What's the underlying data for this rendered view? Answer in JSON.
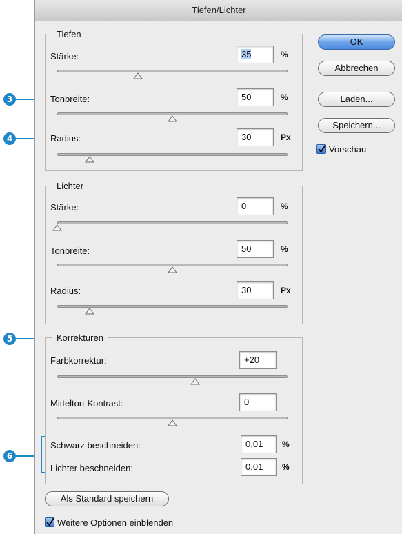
{
  "window": {
    "title": "Tiefen/Lichter"
  },
  "tiefen": {
    "legend": "Tiefen",
    "staerke": {
      "label": "Stärke:",
      "value": "35",
      "unit": "%",
      "slider_fraction": 0.35
    },
    "tonbreite": {
      "label": "Tonbreite:",
      "value": "50",
      "unit": "%",
      "slider_fraction": 0.5
    },
    "radius": {
      "label": "Radius:",
      "value": "30",
      "unit": "Px",
      "slider_fraction": 0.14
    }
  },
  "lichter": {
    "legend": "Lichter",
    "staerke": {
      "label": "Stärke:",
      "value": "0",
      "unit": "%",
      "slider_fraction": 0.0
    },
    "tonbreite": {
      "label": "Tonbreite:",
      "value": "50",
      "unit": "%",
      "slider_fraction": 0.5
    },
    "radius": {
      "label": "Radius:",
      "value": "30",
      "unit": "Px",
      "slider_fraction": 0.14
    }
  },
  "korrekturen": {
    "legend": "Korrekturen",
    "farbkorrektur": {
      "label": "Farbkorrektur:",
      "value": "+20",
      "slider_fraction": 0.6
    },
    "mittelton": {
      "label": "Mittelton-Kontrast:",
      "value": "0",
      "slider_fraction": 0.5
    },
    "schwarz": {
      "label": "Schwarz beschneiden:",
      "value": "0,01",
      "unit": "%"
    },
    "lichter": {
      "label": "Lichter beschneiden:",
      "value": "0,01",
      "unit": "%"
    }
  },
  "buttons": {
    "ok": "OK",
    "abbrechen": "Abbrechen",
    "laden": "Laden...",
    "speichern": "Speichern...",
    "standard": "Als Standard speichern"
  },
  "checkboxes": {
    "vorschau": {
      "label": "Vorschau",
      "checked": true
    },
    "weitere": {
      "label": "Weitere Optionen einblenden",
      "checked": true
    }
  },
  "callouts": {
    "c3": "3",
    "c4": "4",
    "c5": "5",
    "c6": "6"
  },
  "colors": {
    "accent": "#1f86c8",
    "primary_button": "#4b8ae0"
  }
}
